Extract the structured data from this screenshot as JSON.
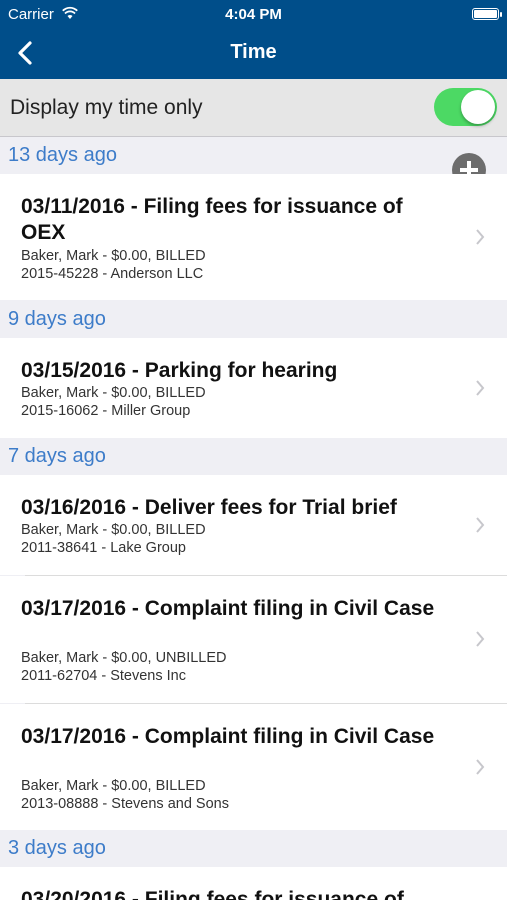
{
  "status_bar": {
    "carrier": "Carrier",
    "time": "4:04 PM"
  },
  "nav": {
    "title": "Time"
  },
  "toggle": {
    "label": "Display my time only",
    "on": true
  },
  "sections": [
    {
      "header": "13 days ago",
      "entries": [
        {
          "title": "03/11/2016 - Filing fees for issuance of OEX",
          "detail": "Baker, Mark - $0.00, BILLED",
          "matter": "2015-45228 - Anderson LLC"
        }
      ]
    },
    {
      "header": "9 days ago",
      "entries": [
        {
          "title": "03/15/2016 - Parking for hearing",
          "detail": "Baker, Mark - $0.00, BILLED",
          "matter": "2015-16062 - Miller Group"
        }
      ]
    },
    {
      "header": "7 days ago",
      "entries": [
        {
          "title": "03/16/2016 - Deliver fees for Trial brief",
          "detail": "Baker, Mark - $0.00, BILLED",
          "matter": "2011-38641 - Lake Group"
        },
        {
          "title": "03/17/2016 - Complaint filing in Civil Case",
          "detail": "Baker, Mark - $0.00, UNBILLED",
          "matter": "2011-62704 - Stevens Inc"
        },
        {
          "title": "03/17/2016 - Complaint filing in Civil Case",
          "detail": "Baker, Mark - $0.00, BILLED",
          "matter": "2013-08888 - Stevens and Sons"
        }
      ]
    },
    {
      "header": "3 days ago",
      "entries": [
        {
          "title": "03/20/2016 - Filing fees for issuance of"
        }
      ]
    }
  ],
  "icons": {
    "back": "chevron-left-icon",
    "add": "plus-circle-icon",
    "row_disclosure": "chevron-right-icon",
    "wifi": "wifi-icon",
    "battery": "battery-icon"
  }
}
